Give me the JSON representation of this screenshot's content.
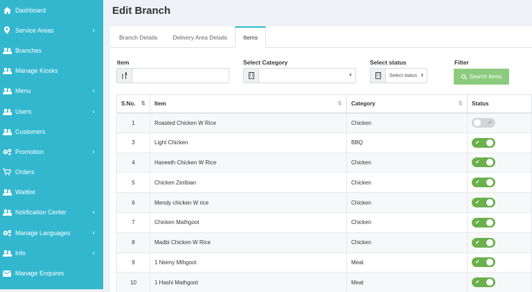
{
  "sidebar": {
    "items": [
      {
        "label": "Dashboard",
        "icon": "home-icon",
        "has_children": false
      },
      {
        "label": "Service Areas",
        "icon": "map-pin-icon",
        "has_children": true
      },
      {
        "label": "Branches",
        "icon": "users-icon",
        "has_children": false
      },
      {
        "label": "Manage Kiosks",
        "icon": "users-icon",
        "has_children": false
      },
      {
        "label": "Menu",
        "icon": "users-icon",
        "has_children": true
      },
      {
        "label": "Users",
        "icon": "users-icon",
        "has_children": true
      },
      {
        "label": "Customers",
        "icon": "users-icon",
        "has_children": false
      },
      {
        "label": "Promotion",
        "icon": "gears-icon",
        "has_children": true
      },
      {
        "label": "Orders",
        "icon": "cart-icon",
        "has_children": false
      },
      {
        "label": "Waitlist",
        "icon": "users-icon",
        "has_children": false
      },
      {
        "label": "Notification Center",
        "icon": "users-icon",
        "has_children": true
      },
      {
        "label": "Manage Languages",
        "icon": "gears-icon",
        "has_children": true
      },
      {
        "label": "Info",
        "icon": "users-icon",
        "has_children": true
      },
      {
        "label": "Manage Enquires",
        "icon": "envelope-icon",
        "has_children": false
      }
    ],
    "chevron": "‹"
  },
  "page": {
    "title": "Edit Branch"
  },
  "tabs": [
    {
      "label": "Branch Details",
      "active": false
    },
    {
      "label": "Delivery Area Details",
      "active": false
    },
    {
      "label": "Items",
      "active": true
    }
  ],
  "filters": {
    "item_label": "Item",
    "item_value": "",
    "category_label": "Select Category",
    "category_value": "",
    "status_label": "Select status",
    "status_value": "Select status",
    "filter_label": "Filter",
    "search_button": "Search items"
  },
  "table": {
    "headers": [
      "S.No.",
      "Item",
      "Category",
      "Status"
    ],
    "rows": [
      {
        "sno": "1",
        "item": "Roasted Chicken W Rice",
        "category": "Chicken",
        "status": false
      },
      {
        "sno": "3",
        "item": "Light Chicken",
        "category": "BBQ",
        "status": true
      },
      {
        "sno": "4",
        "item": "Haneeth Chicken W Rice",
        "category": "Chicken",
        "status": true
      },
      {
        "sno": "5",
        "item": "Chicken Zeribian",
        "category": "Chicken",
        "status": true
      },
      {
        "sno": "6",
        "item": "Mendy chicken W rice",
        "category": "Chicken",
        "status": true
      },
      {
        "sno": "7",
        "item": "Chicken Mathgoot",
        "category": "Chicken",
        "status": true
      },
      {
        "sno": "8",
        "item": "Madbi Chicken W Rice",
        "category": "Chicken",
        "status": true
      },
      {
        "sno": "9",
        "item": "1 Neimy Mthgoot",
        "category": "Meat",
        "status": true
      },
      {
        "sno": "10",
        "item": "1 Hashi Mathgoot",
        "category": "Meat",
        "status": true
      }
    ]
  },
  "colors": {
    "sidebar": "#33b7cf",
    "toggle_on": "#6ab04c",
    "toggle_off": "#d3d6d9",
    "search_button": "#8ccb7d"
  }
}
